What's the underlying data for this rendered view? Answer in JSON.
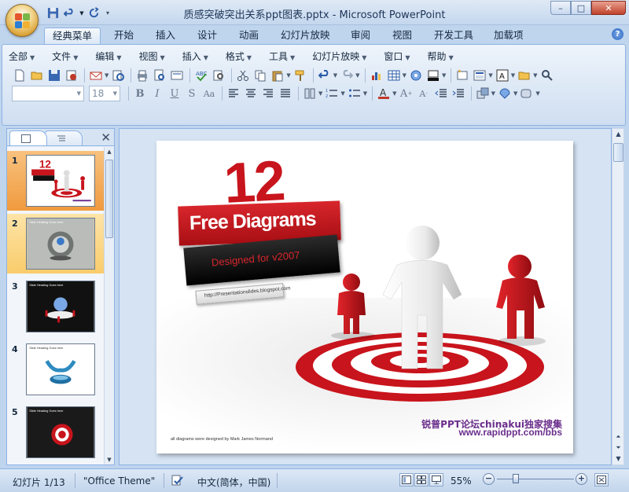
{
  "window": {
    "title": "质感突破突出关系ppt图表.pptx - Microsoft PowerPoint",
    "controls": [
      "–",
      "□",
      "✕"
    ]
  },
  "ribbon_tabs": [
    "经典菜单",
    "开始",
    "插入",
    "设计",
    "动画",
    "幻灯片放映",
    "审阅",
    "视图",
    "开发工具",
    "加载项"
  ],
  "active_tab": "经典菜单",
  "classic_menu": [
    "全部",
    "文件",
    "编辑",
    "视图",
    "插入",
    "格式",
    "工具",
    "幻灯片放映",
    "窗口",
    "帮助"
  ],
  "font_size_value": "18",
  "font_name_value": "",
  "slide_pane": {
    "thumbnails": [
      {
        "number": "1",
        "state": "selected"
      },
      {
        "number": "2",
        "state": "hover"
      },
      {
        "number": "3",
        "state": "normal"
      },
      {
        "number": "4",
        "state": "normal"
      },
      {
        "number": "5",
        "state": "normal"
      }
    ],
    "thumb_caption": "Slide Heading Goes here"
  },
  "slide": {
    "big_number": "12",
    "banner_title": "Free Diagrams",
    "banner_subtitle": "Designed for v2007",
    "url_tag": "http://Presentationslides.blogspot.com",
    "footer_note": "all diagrams were designed by Mark James Normand",
    "forum_line1": "锐普PPT论坛chinakui独家搜集",
    "forum_line2": "www.rapidppt.com/bbs",
    "colors": {
      "red": "#c8141c",
      "purple": "#6a2e8c"
    }
  },
  "statusbar": {
    "slide_indicator": "幻灯片 1/13",
    "theme": "\"Office Theme\"",
    "language": "中文(简体，中国)",
    "zoom": "55%"
  }
}
